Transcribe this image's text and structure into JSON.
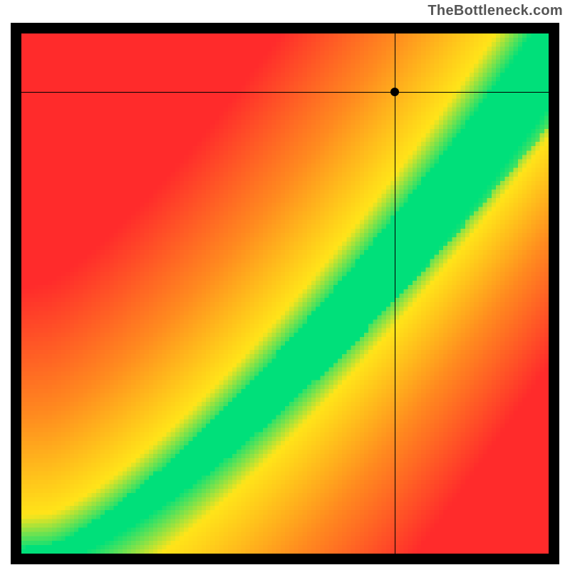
{
  "attribution": "TheBottleneck.com",
  "colors": {
    "red": "#ff2b2b",
    "orange": "#ff8a1f",
    "yellow": "#ffe419",
    "green": "#00e07a"
  },
  "chart_data": {
    "type": "heatmap",
    "title": "",
    "xlabel": "",
    "ylabel": "",
    "x_range": [
      0,
      1
    ],
    "y_range": [
      0,
      1
    ],
    "optimal_curve": {
      "description": "approximate green ridge y = (x - 0.05)^1.35 over [0,1]; green band half-width grows with x",
      "exponent": 1.35,
      "x_offset": 0.05,
      "min_band_halfwidth": 0.012,
      "band_growth": 0.1
    },
    "marker": {
      "x_frac": 0.708,
      "y_frac": 0.888
    },
    "crosshair": {
      "x_frac": 0.708,
      "y_frac": 0.888
    }
  }
}
